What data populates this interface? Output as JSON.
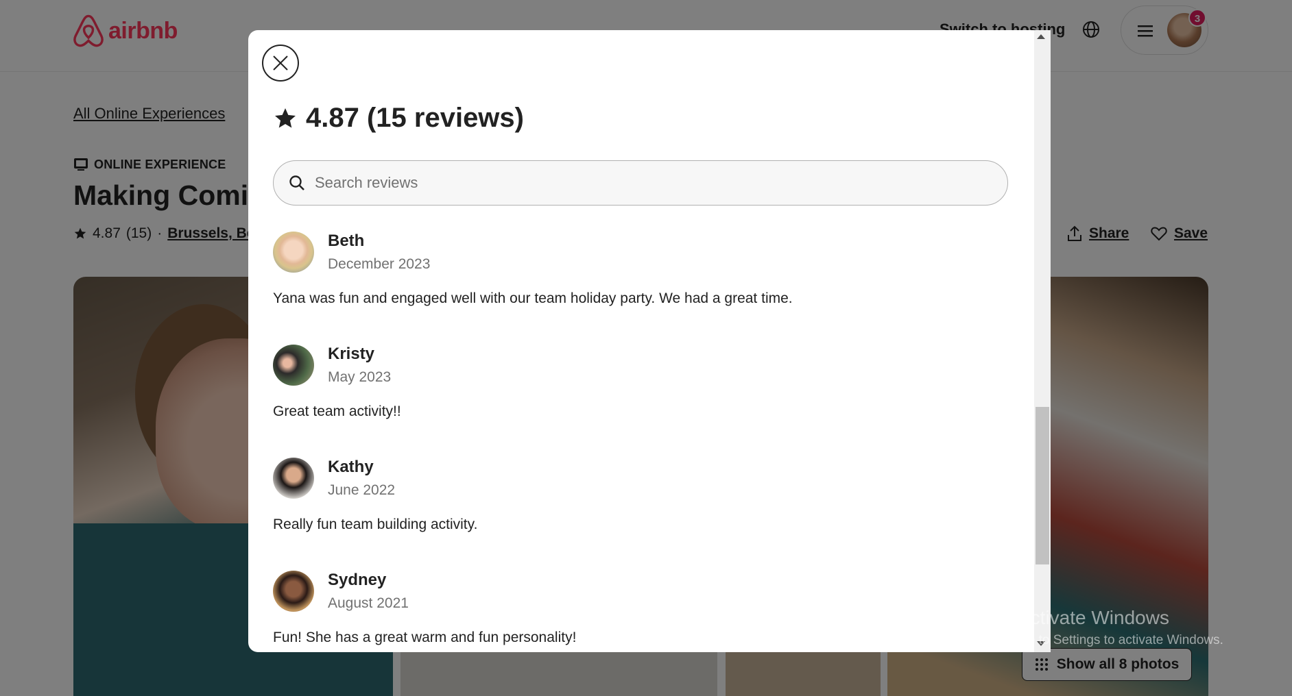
{
  "header": {
    "logo_text": "airbnb",
    "switch_hosting": "Switch to hosting",
    "notification_count": "3"
  },
  "listing": {
    "breadcrumb": "All Online Experiences",
    "experience_type": "ONLINE EXPERIENCE",
    "title": "Making Comic",
    "rating": "4.87",
    "review_count": "(15)",
    "separator": "·",
    "location": "Brussels, Bel",
    "share_label": "Share",
    "save_label": "Save",
    "show_all_photos": "Show all 8 photos"
  },
  "modal": {
    "rating_title": "4.87 (15 reviews)",
    "search_placeholder": "Search reviews",
    "reviews": [
      {
        "name": "Beth",
        "date": "December 2023",
        "text": "Yana was fun and engaged well with our team holiday party. We had a great time."
      },
      {
        "name": "Kristy",
        "date": "May 2023",
        "text": "Great team activity!!"
      },
      {
        "name": "Kathy",
        "date": "June 2022",
        "text": "Really fun team building activity."
      },
      {
        "name": "Sydney",
        "date": "August 2021",
        "text": "Fun! She has a great warm and fun personality!"
      }
    ]
  },
  "watermark": {
    "line1": "Activate Windows",
    "line2": "Go to Settings to activate Windows."
  },
  "colors": {
    "brand": "#ff385c",
    "notification": "#e31c5f",
    "text": "#222222",
    "muted": "#717171"
  },
  "icons": [
    "airbnb-logo-icon",
    "globe-icon",
    "hamburger-icon",
    "star-icon",
    "share-icon",
    "heart-icon",
    "grid-icon",
    "close-icon",
    "search-icon",
    "online-experience-icon"
  ]
}
